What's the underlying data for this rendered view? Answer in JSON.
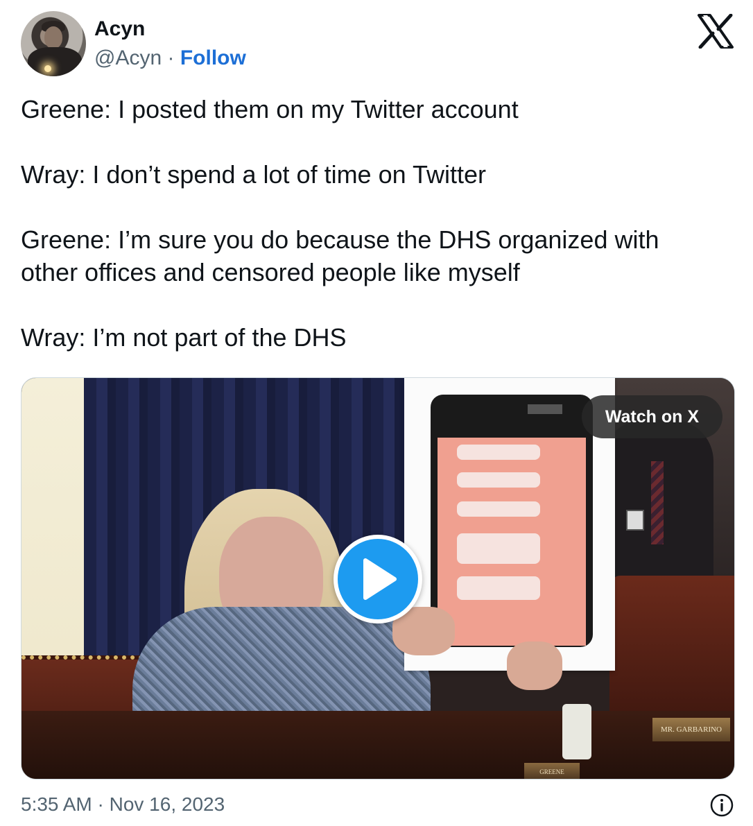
{
  "author": {
    "display_name": "Acyn",
    "handle": "@Acyn",
    "separator": "·",
    "follow_label": "Follow",
    "avatar_icon": "user-avatar"
  },
  "brand": {
    "logo_icon": "x-logo-icon"
  },
  "tweet": {
    "text": "Greene: I posted them on my Twitter account\n\nWray: I don’t spend a lot of time on Twitter\n\nGreene: I’m sure you do because the DHS organized with other offices and censored people like myself\n\nWray: I’m not part of the DHS"
  },
  "media": {
    "watch_label": "Watch on X",
    "play_icon": "play-icon",
    "placard_right": "MR. GARBARINO",
    "placard_left": "GREENE"
  },
  "footer": {
    "timestamp": "5:35 AM · Nov 16, 2023",
    "info_icon": "info-icon"
  },
  "colors": {
    "follow_blue": "#1d6fd6",
    "play_blue": "#1d9bf0",
    "muted_text": "#536471"
  }
}
